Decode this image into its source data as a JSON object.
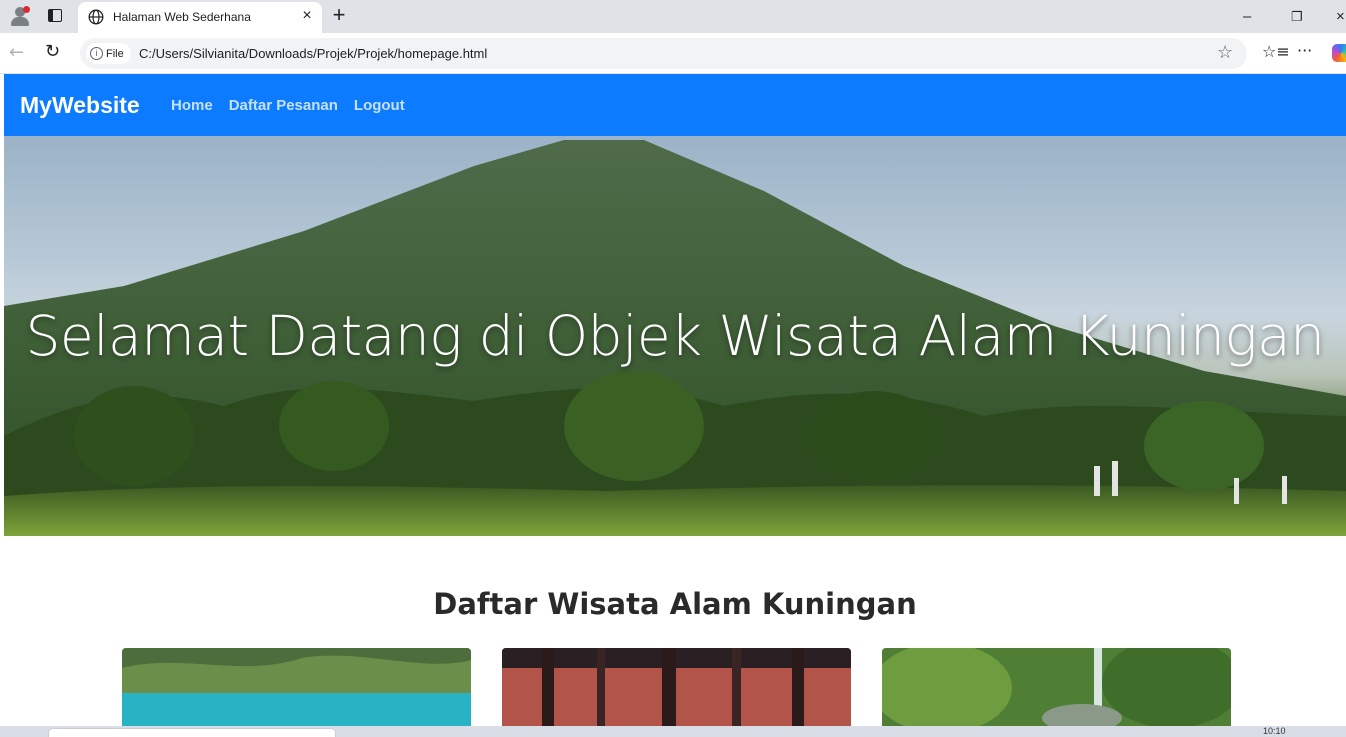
{
  "browser": {
    "tab_title": "Halaman Web Sederhana",
    "tab_close": "×",
    "new_tab": "+",
    "window_min": "–",
    "window_restore": "❐",
    "window_close": "×",
    "back_icon": "←",
    "reload_icon": "↻",
    "info_label": "File",
    "url": "C:/Users/Silvianita/Downloads/Projek/Projek/homepage.html",
    "star_icon": "☆",
    "favorites_icon": "☆≡",
    "more_icon": "···"
  },
  "navbar": {
    "brand": "MyWebsite",
    "links": [
      "Home",
      "Daftar Pesanan",
      "Logout"
    ],
    "color": "#0d7bff"
  },
  "hero": {
    "title": "Selamat Datang di Objek Wisata Alam Kuningan"
  },
  "section": {
    "title": "Daftar Wisata Alam Kuningan"
  },
  "cards": [
    {
      "image": "lake-photo"
    },
    {
      "image": "forest-photo"
    },
    {
      "image": "waterfall-photo"
    }
  ],
  "taskbar": {
    "clock": "10:10"
  }
}
